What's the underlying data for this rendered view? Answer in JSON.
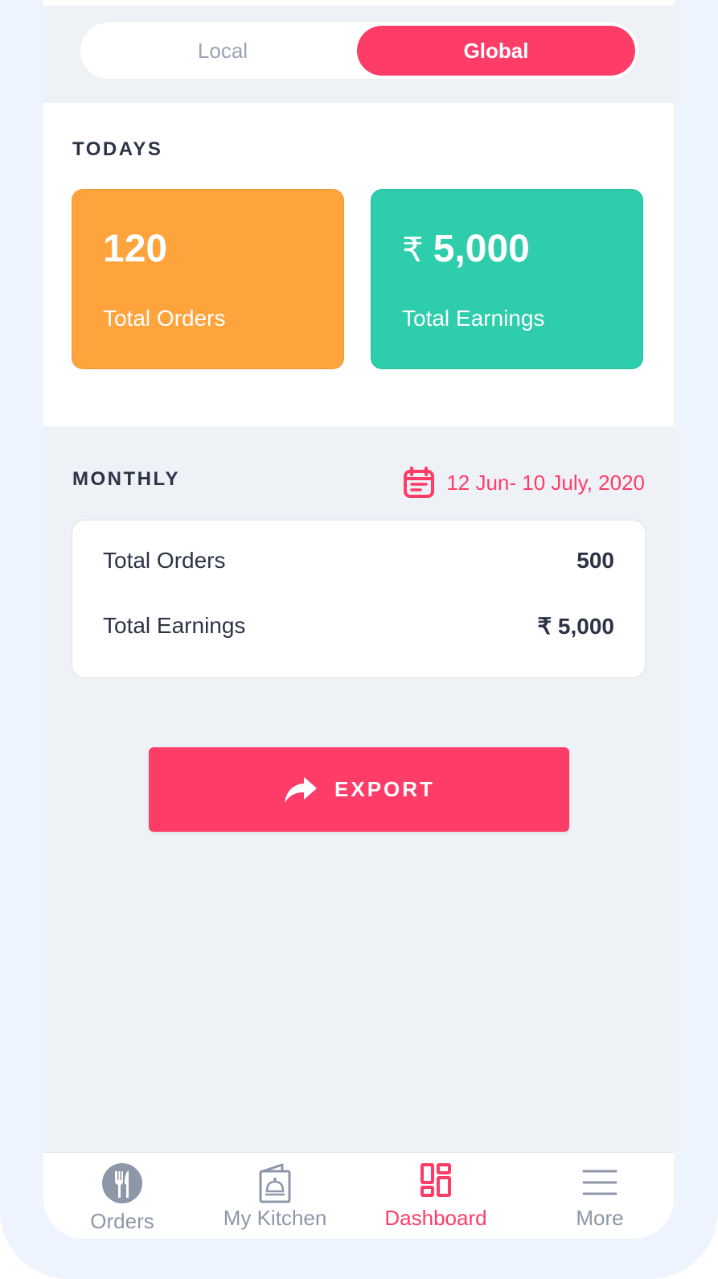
{
  "toggle": {
    "local_label": "Local",
    "global_label": "Global",
    "active": "Global"
  },
  "today": {
    "title": "TODAYS",
    "orders": {
      "value": "120",
      "label": "Total Orders"
    },
    "earnings": {
      "currency": "₹",
      "value": "5,000",
      "label": "Total Earnings"
    }
  },
  "monthly": {
    "title": "MONTHLY",
    "date_range": "12 Jun- 10 July, 2020",
    "rows": [
      {
        "label": "Total Orders",
        "value": "500"
      },
      {
        "label": "Total Earnings",
        "value": "₹ 5,000"
      }
    ]
  },
  "export": {
    "label": "EXPORT"
  },
  "tabbar": {
    "items": [
      {
        "label": "Orders",
        "icon": "fork-knife-icon"
      },
      {
        "label": "My Kitchen",
        "icon": "cloche-menu-icon"
      },
      {
        "label": "Dashboard",
        "icon": "dashboard-grid-icon"
      },
      {
        "label": "More",
        "icon": "menu-lines-icon"
      }
    ],
    "active": "Dashboard"
  },
  "colors": {
    "accent": "#fd3c67",
    "orders_card": "#ffa33d",
    "earnings_card": "#2ecdab",
    "text_dark": "#2b3345",
    "text_muted": "#8d97a8",
    "background": "#eef2f7"
  }
}
